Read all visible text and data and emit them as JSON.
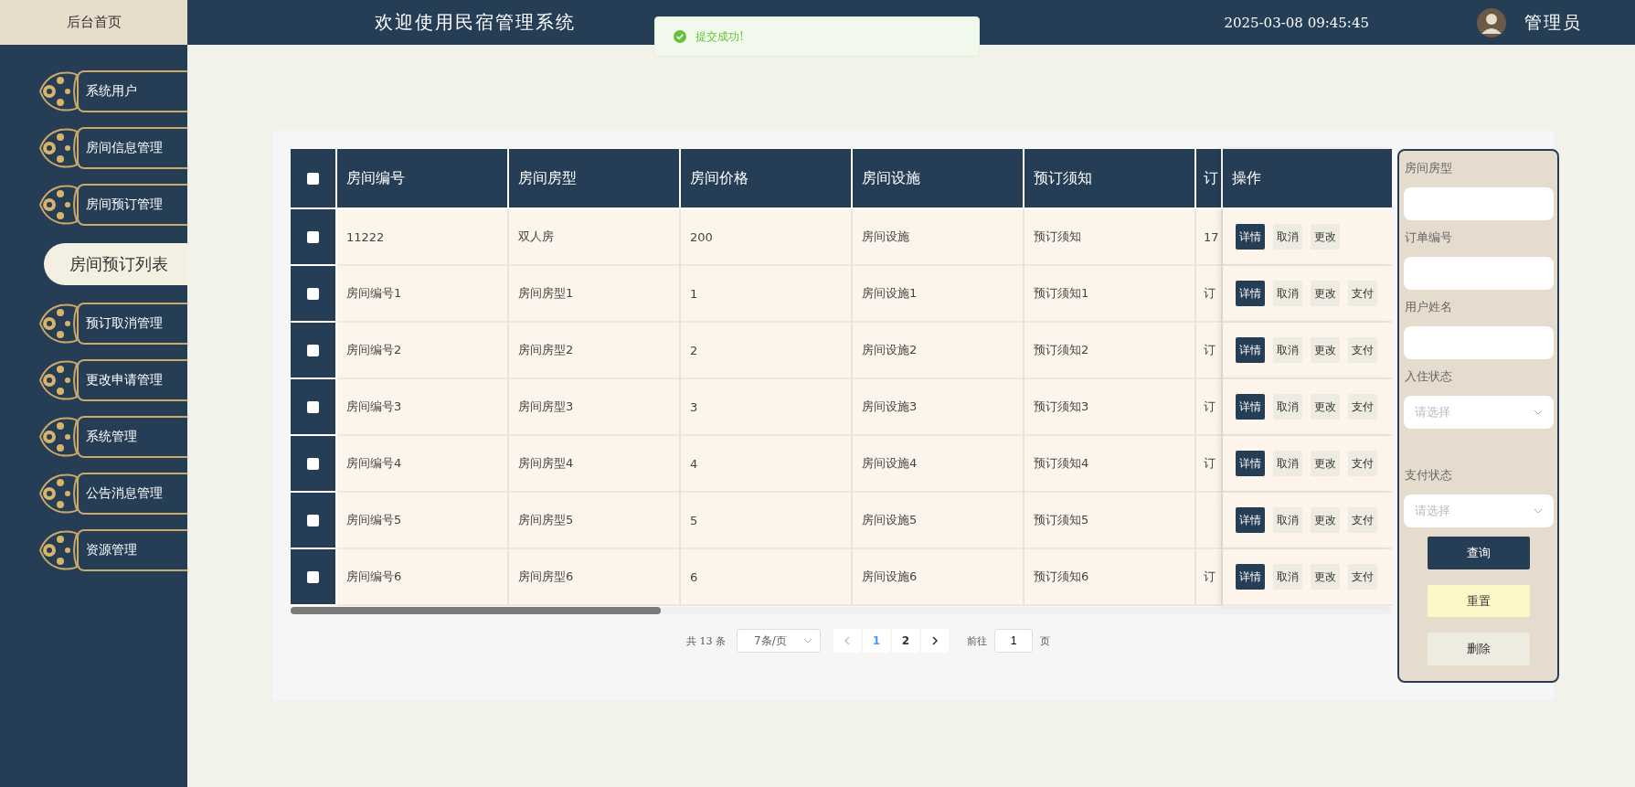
{
  "topbar": {
    "home": "后台首页",
    "title": "欢迎使用民宿管理系统",
    "datetime": "2025-03-08 09:45:45",
    "user": "管理员"
  },
  "toast": {
    "kind": "success",
    "message": "提交成功!"
  },
  "sidebar": {
    "items": [
      {
        "label": "系统用户"
      },
      {
        "label": "房间信息管理"
      },
      {
        "label": "房间预订管理",
        "children": [
          {
            "label": "房间预订列表",
            "selected": true
          }
        ]
      },
      {
        "label": "预订取消管理"
      },
      {
        "label": "更改申请管理"
      },
      {
        "label": "系统管理"
      },
      {
        "label": "公告消息管理"
      },
      {
        "label": "资源管理"
      }
    ]
  },
  "table": {
    "select_all": {
      "checked": false
    },
    "columns": [
      "房间编号",
      "房间房型",
      "房间价格",
      "房间设施",
      "预订须知",
      "订",
      "操作"
    ],
    "rows": [
      {
        "checked": false,
        "cells": [
          "11222",
          "双人房",
          "200",
          "房间设施",
          "预订须知",
          "17"
        ],
        "actions": [
          {
            "label": "详情",
            "kind": "primary"
          },
          {
            "label": "取消",
            "kind": "plain"
          },
          {
            "label": "更改",
            "kind": "plain"
          }
        ]
      },
      {
        "checked": false,
        "cells": [
          "房间编号1",
          "房间房型1",
          "1",
          "房间设施1",
          "预订须知1",
          "订"
        ],
        "actions": [
          {
            "label": "详情",
            "kind": "primary"
          },
          {
            "label": "取消",
            "kind": "plain"
          },
          {
            "label": "更改",
            "kind": "plain"
          },
          {
            "label": "支付",
            "kind": "plain"
          }
        ]
      },
      {
        "checked": false,
        "cells": [
          "房间编号2",
          "房间房型2",
          "2",
          "房间设施2",
          "预订须知2",
          "订"
        ],
        "actions": [
          {
            "label": "详情",
            "kind": "primary"
          },
          {
            "label": "取消",
            "kind": "plain"
          },
          {
            "label": "更改",
            "kind": "plain"
          },
          {
            "label": "支付",
            "kind": "plain"
          }
        ]
      },
      {
        "checked": false,
        "cells": [
          "房间编号3",
          "房间房型3",
          "3",
          "房间设施3",
          "预订须知3",
          "订"
        ],
        "actions": [
          {
            "label": "详情",
            "kind": "primary"
          },
          {
            "label": "取消",
            "kind": "plain"
          },
          {
            "label": "更改",
            "kind": "plain"
          },
          {
            "label": "支付",
            "kind": "plain"
          }
        ]
      },
      {
        "checked": false,
        "cells": [
          "房间编号4",
          "房间房型4",
          "4",
          "房间设施4",
          "预订须知4",
          "订"
        ],
        "actions": [
          {
            "label": "详情",
            "kind": "primary"
          },
          {
            "label": "取消",
            "kind": "plain"
          },
          {
            "label": "更改",
            "kind": "plain"
          },
          {
            "label": "支付",
            "kind": "plain"
          }
        ]
      },
      {
        "checked": false,
        "cells": [
          "房间编号5",
          "房间房型5",
          "5",
          "房间设施5",
          "预订须知5",
          ""
        ],
        "actions": [
          {
            "label": "详情",
            "kind": "primary"
          },
          {
            "label": "取消",
            "kind": "plain"
          },
          {
            "label": "更改",
            "kind": "plain"
          },
          {
            "label": "支付",
            "kind": "plain"
          }
        ]
      },
      {
        "checked": false,
        "cells": [
          "房间编号6",
          "房间房型6",
          "6",
          "房间设施6",
          "预订须知6",
          "订"
        ],
        "actions": [
          {
            "label": "详情",
            "kind": "primary"
          },
          {
            "label": "取消",
            "kind": "plain"
          },
          {
            "label": "更改",
            "kind": "plain"
          },
          {
            "label": "支付",
            "kind": "plain"
          }
        ]
      }
    ]
  },
  "pagination": {
    "total": "共 13 条",
    "page_size": "7条/页",
    "pages": [
      {
        "label": "1",
        "selected": true
      },
      {
        "label": "2",
        "selected": false
      }
    ],
    "goto_label": "前往",
    "goto_value": "1",
    "goto_suffix": "页"
  },
  "filter": {
    "fields": [
      {
        "label": "房间房型",
        "kind": "text"
      },
      {
        "label": "订单编号",
        "kind": "text"
      },
      {
        "label": "用户姓名",
        "kind": "text"
      },
      {
        "label": "入住状态",
        "kind": "select",
        "placeholder": "请选择"
      },
      {
        "label": "支付状态",
        "kind": "select",
        "placeholder": "请选择"
      }
    ],
    "buttons": [
      {
        "label": "查询",
        "kind": "primary"
      },
      {
        "label": "重置",
        "kind": "warning"
      },
      {
        "label": "删除",
        "kind": "plain"
      }
    ]
  }
}
